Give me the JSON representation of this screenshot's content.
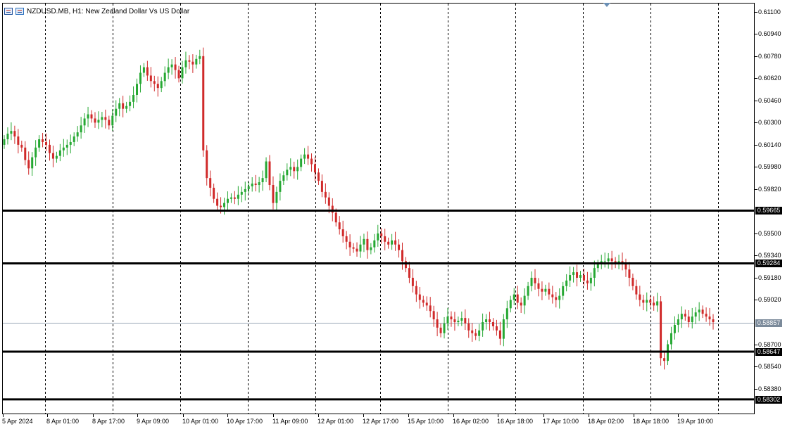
{
  "window": {
    "title": "NZDUSD.MB, H1:  New Zealand Dollar Vs US Dollar"
  },
  "icons": {
    "chart_menu": "chart-menu-icon",
    "chart_window": "chart-window-icon"
  },
  "colors": {
    "bull": "#26a833",
    "bear": "#d02a2a",
    "grid": "#000000",
    "current_line": "#9aa8b6",
    "hline": "#000000"
  },
  "chart_data": {
    "type": "candlestick",
    "symbol": "NZDUSD.MB",
    "timeframe": "H1",
    "ylim": [
      0.582,
      0.6116
    ],
    "y_ticks": [
      "0.61100",
      "0.60940",
      "0.60780",
      "0.60620",
      "0.60460",
      "0.60300",
      "0.60140",
      "0.59980",
      "0.59820",
      "0.59500",
      "0.59340",
      "0.59180",
      "0.59020",
      "0.58700",
      "0.58540",
      "0.58380"
    ],
    "x_ticks": [
      "5 Apr 2024",
      "8 Apr 01:00",
      "8 Apr 17:00",
      "9 Apr 09:00",
      "10 Apr 01:00",
      "10 Apr 17:00",
      "11 Apr 09:00",
      "12 Apr 01:00",
      "12 Apr 17:00",
      "15 Apr 10:00",
      "16 Apr 02:00",
      "16 Apr 18:00",
      "17 Apr 10:00",
      "18 Apr 02:00",
      "18 Apr 18:00",
      "19 Apr 10:00"
    ],
    "horizontal_lines": [
      "0.59665",
      "0.59284",
      "0.58647",
      "0.58302"
    ],
    "current_price": "0.58857",
    "close_path": [
      0.6018,
      0.6022,
      0.6024,
      0.602,
      0.6014,
      0.6012,
      0.6003,
      0.5997,
      0.6005,
      0.6012,
      0.6018,
      0.6016,
      0.6014,
      0.6008,
      0.6004,
      0.6006,
      0.601,
      0.6012,
      0.6014,
      0.6016,
      0.602,
      0.6023,
      0.6028,
      0.6033,
      0.6036,
      0.6033,
      0.603,
      0.6032,
      0.6034,
      0.6032,
      0.6028,
      0.6035,
      0.604,
      0.6044,
      0.604,
      0.6042,
      0.6045,
      0.605,
      0.6058,
      0.6066,
      0.607,
      0.6064,
      0.606,
      0.6058,
      0.6055,
      0.606,
      0.6066,
      0.607,
      0.6072,
      0.6068,
      0.6062,
      0.607,
      0.6075,
      0.6074,
      0.6072,
      0.6076,
      0.6078,
      0.601,
      0.599,
      0.5983,
      0.5975,
      0.597,
      0.5969,
      0.5972,
      0.5975,
      0.5976,
      0.5975,
      0.5978,
      0.598,
      0.5982,
      0.5984,
      0.5986,
      0.5985,
      0.5987,
      0.599,
      0.6002,
      0.5985,
      0.5972,
      0.598,
      0.5988,
      0.5992,
      0.5996,
      0.5998,
      0.5995,
      0.5998,
      0.6004,
      0.6007,
      0.6004,
      0.6,
      0.5994,
      0.5988,
      0.598,
      0.5976,
      0.597,
      0.5965,
      0.5958,
      0.5953,
      0.5948,
      0.5944,
      0.594,
      0.5939,
      0.5937,
      0.5942,
      0.5946,
      0.5938,
      0.594,
      0.5945,
      0.595,
      0.5948,
      0.5944,
      0.5942,
      0.5945,
      0.5942,
      0.5938,
      0.593,
      0.5925,
      0.5918,
      0.5912,
      0.5906,
      0.5902,
      0.59,
      0.5898,
      0.5894,
      0.5888,
      0.5882,
      0.5878,
      0.5885,
      0.589,
      0.5888,
      0.5886,
      0.5887,
      0.5889,
      0.5885,
      0.588,
      0.5878,
      0.5876,
      0.588,
      0.5886,
      0.5888,
      0.5886,
      0.5883,
      0.588,
      0.5874,
      0.5888,
      0.5896,
      0.5902,
      0.5906,
      0.59,
      0.5898,
      0.5905,
      0.5912,
      0.5918,
      0.5914,
      0.591,
      0.5908,
      0.591,
      0.5906,
      0.5904,
      0.5902,
      0.5905,
      0.5912,
      0.5916,
      0.592,
      0.5922,
      0.5918,
      0.592,
      0.5916,
      0.5914,
      0.5918,
      0.5925,
      0.5928,
      0.593,
      0.593,
      0.5932,
      0.593,
      0.5928,
      0.593,
      0.5928,
      0.5924,
      0.5918,
      0.5912,
      0.5906,
      0.5902,
      0.59,
      0.5902,
      0.59,
      0.5898,
      0.5901,
      0.586,
      0.5858,
      0.587,
      0.5878,
      0.5884,
      0.5888,
      0.5892,
      0.589,
      0.5886,
      0.589,
      0.5893,
      0.5895,
      0.5892,
      0.589,
      0.5888,
      0.5886
    ]
  }
}
